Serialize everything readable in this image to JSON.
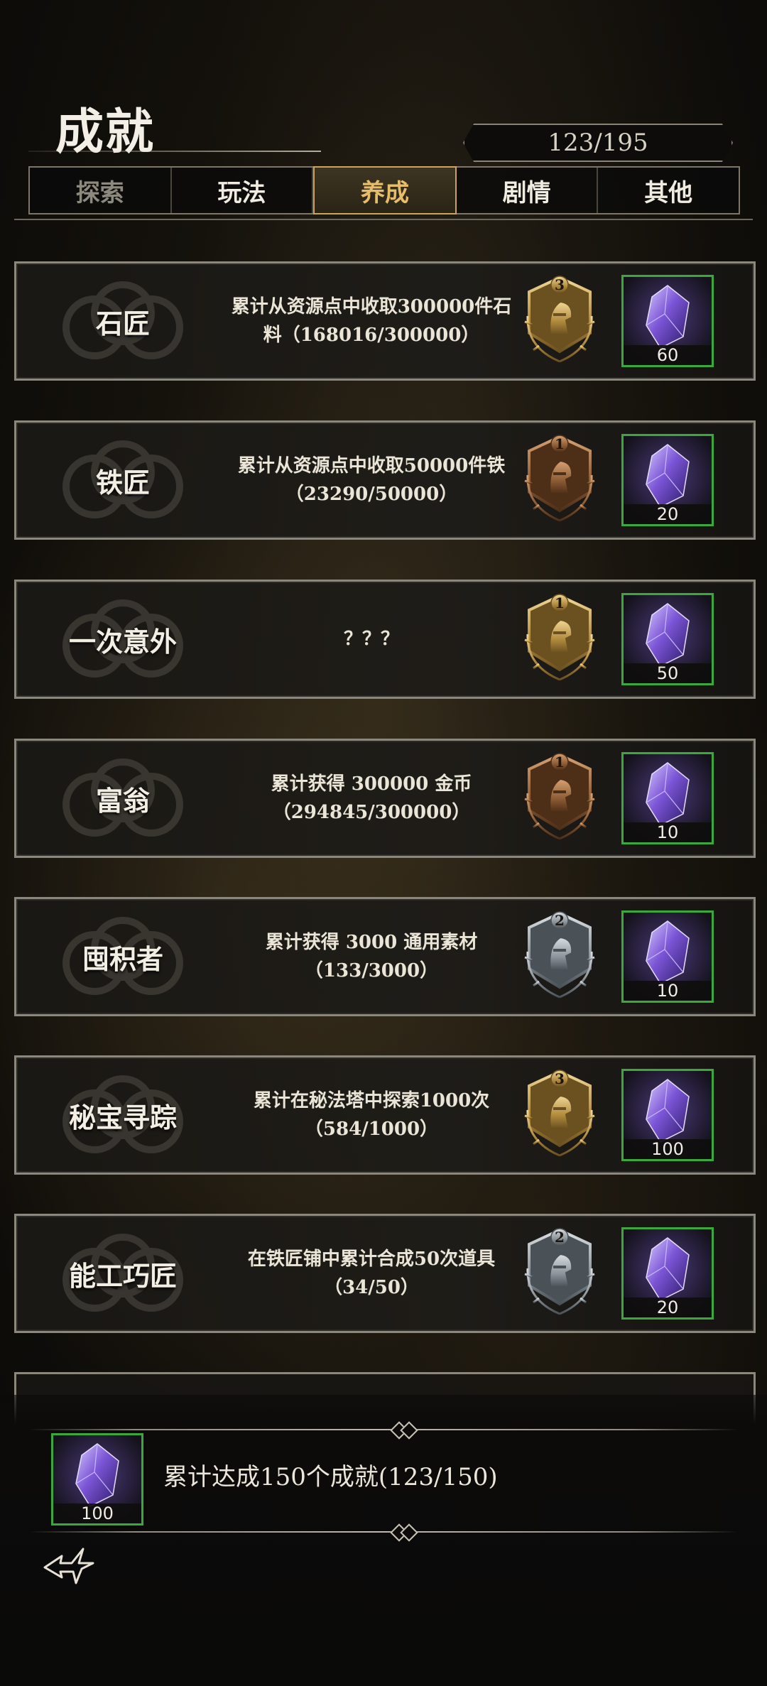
{
  "header": {
    "title": "成就",
    "progress": "123/195"
  },
  "tabs": [
    {
      "label": "探索",
      "state": "dim"
    },
    {
      "label": "玩法",
      "state": "normal"
    },
    {
      "label": "养成",
      "state": "active"
    },
    {
      "label": "剧情",
      "state": "normal"
    },
    {
      "label": "其他",
      "state": "normal"
    }
  ],
  "achievements": [
    {
      "name": "石匠",
      "desc_line1": "累计从资源点中收取300000件石",
      "desc_line2": "料（168016/300000）",
      "medal_tier": "gold",
      "medal_level": "3",
      "reward_count": "60"
    },
    {
      "name": "铁匠",
      "desc_line1": "累计从资源点中收取50000件铁",
      "desc_line2": "（23290/50000）",
      "medal_tier": "bronze",
      "medal_level": "1",
      "reward_count": "20"
    },
    {
      "name": "一次意外",
      "desc_line1": "？？？",
      "desc_line2": "",
      "medal_tier": "knight",
      "medal_level": "1",
      "reward_count": "50"
    },
    {
      "name": "富翁",
      "desc_line1": "累计获得 300000 金币",
      "desc_line2": "（294845/300000）",
      "medal_tier": "bronze",
      "medal_level": "1",
      "reward_count": "10"
    },
    {
      "name": "囤积者",
      "desc_line1": "累计获得 3000 通用素材",
      "desc_line2": "（133/3000）",
      "medal_tier": "silver",
      "medal_level": "2",
      "reward_count": "10"
    },
    {
      "name": "秘宝寻踪",
      "desc_line1": "累计在秘法塔中探索1000次",
      "desc_line2": "（584/1000）",
      "medal_tier": "gold",
      "medal_level": "3",
      "reward_count": "100"
    },
    {
      "name": "能工巧匠",
      "desc_line1": "在铁匠铺中累计合成50次道具",
      "desc_line2": "（34/50）",
      "medal_tier": "silver",
      "medal_level": "2",
      "reward_count": "20"
    }
  ],
  "summary": {
    "text": "累计达成150个成就(123/150)",
    "reward_count": "100"
  },
  "icons": {
    "back": "back-arrow-icon",
    "reward": "purple-crystal-icon",
    "medal": "laurel-medal-icon"
  },
  "colors": {
    "gold": "#c9a24f",
    "bronze": "#9a6a3e",
    "silver": "#8e969b",
    "reward_border": "#3aa83d",
    "active_tab": "#e6bd6a"
  }
}
